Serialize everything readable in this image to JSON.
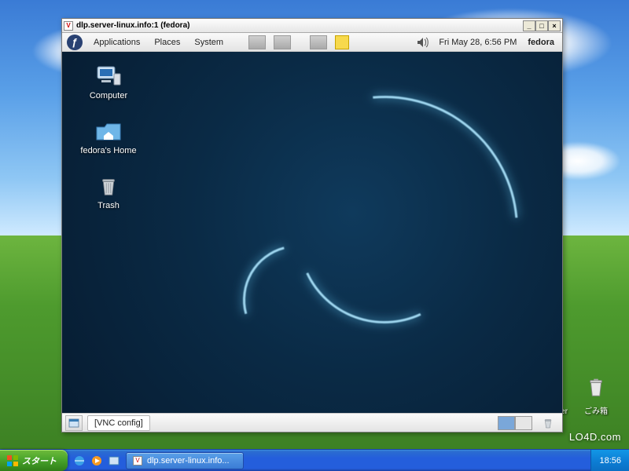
{
  "watermark": "LO4D.com",
  "xp": {
    "taskbar": {
      "start_label": "スタート",
      "task_button_label": "dlp.server-linux.info...",
      "clock": "18:56",
      "quick_launch": [
        "ie-icon",
        "media-icon",
        "show-desktop-icon"
      ]
    },
    "desktop_icons": [
      {
        "name": "computer-icon",
        "label": "Computer"
      },
      {
        "name": "trash-icon",
        "label": "ごみ箱"
      }
    ]
  },
  "vnc": {
    "titlebar_text": "dlp.server-linux.info:1 (fedora)",
    "window_controls": {
      "minimize": "_",
      "maximize": "□",
      "close": "×"
    },
    "gnome": {
      "top_panel": {
        "menus": [
          "Applications",
          "Places",
          "System"
        ],
        "clock": "Fri May 28,  6:56 PM",
        "user_label": "fedora"
      },
      "desktop_icons": [
        {
          "name": "computer-icon",
          "label": "Computer"
        },
        {
          "name": "home-folder-icon",
          "label": "fedora's Home"
        },
        {
          "name": "trash-icon",
          "label": "Trash"
        }
      ],
      "bottom_panel": {
        "task_button": "[VNC config]",
        "workspaces": 2,
        "active_workspace": 0
      }
    }
  },
  "colors": {
    "xp_blue": "#245edc",
    "xp_green_start": "#4aa52c",
    "fedora_blue": "#294172",
    "gnome_bg_center": "#0f3a5c",
    "swirl_glow": "#6fd6ff"
  }
}
